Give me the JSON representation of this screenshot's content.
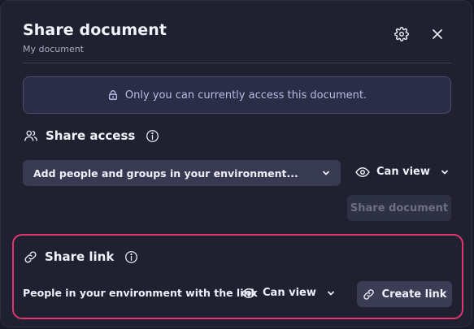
{
  "dialog": {
    "title": "Share document",
    "subtitle": "My document",
    "settings_icon": "gear-icon",
    "close_icon": "close-icon"
  },
  "notice": {
    "icon": "lock-icon",
    "text": "Only you can currently access this document."
  },
  "share_access": {
    "title": "Share access",
    "icon": "users-icon",
    "info_icon": "info-icon",
    "add_people_label": "Add people and groups in your environment...",
    "permission": "Can view",
    "share_button": "Share document",
    "share_button_enabled": false
  },
  "share_link": {
    "title": "Share link",
    "icon": "link-icon",
    "info_icon": "info-icon",
    "description": "People in your environment with the link",
    "permission": "Can view",
    "create_button": "Create link"
  },
  "colors": {
    "dialog_bg": "#1f2030",
    "notice_bg": "#2b2d46",
    "notice_text": "#b8bbe6",
    "highlight_border": "#e0356f",
    "button_bg": "#3b3d54"
  }
}
